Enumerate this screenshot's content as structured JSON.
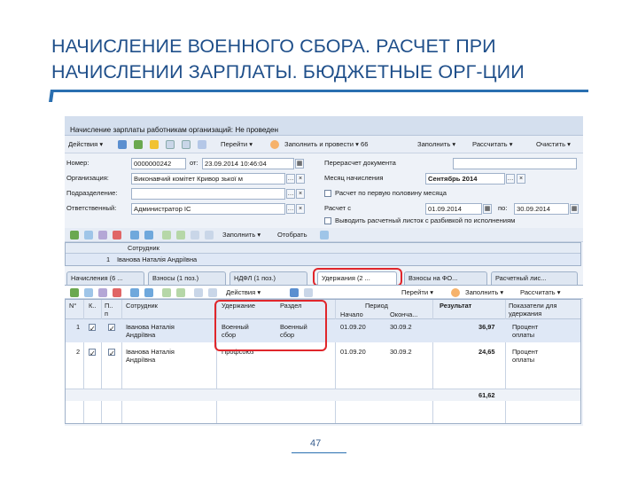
{
  "slide": {
    "title_line1": "НАЧИСЛЕНИЕ ВОЕННОГО СБОРА. РАСЧЕТ ПРИ",
    "title_line2": "НАЧИСЛЕНИИ ЗАРПЛАТЫ. БЮДЖЕТНЫЕ ОРГ-ЦИИ",
    "page_number": "47"
  },
  "window": {
    "title": "Начисление зарплаты работникам организаций: Не проведен"
  },
  "toolbar": {
    "actions": "Действия ▾",
    "goto": "Перейти ▾",
    "fill_create": "Заполнить и провести ▾ 66",
    "fill": "Заполнить ▾",
    "calculate": "Рассчитать ▾",
    "clear": "Очистить ▾"
  },
  "form": {
    "number_label": "Номер:",
    "number_value": "0000000242",
    "from_label": "от:",
    "date_value": "23.09.2014 10:46:04",
    "org_label": "Организация:",
    "org_value": "Виконавчий комітет Кривор зької м",
    "dept_label": "Подразделение:",
    "dept_value": "",
    "resp_label": "Ответственный:",
    "resp_value": "Администратор ІС",
    "recalc_label": "Перерасчет документа",
    "month_label": "Месяц начисления",
    "month_value": "Сентябрь 2014",
    "half_label": "Расчет по первую половину месяца",
    "calc_from_label": "Расчет с",
    "calc_from_value": "01.09.2014",
    "calc_to_label": "по:",
    "calc_to_value": "30.09.2014",
    "separate_label": "Выводить расчетный листок с разбивкой по исполнениям"
  },
  "employees_toolbar": {
    "fill": "Заполнить ▾",
    "select": "Отобрать"
  },
  "employees": {
    "col_employee": "Сотрудник",
    "rows": [
      {
        "num": "1",
        "name": "Іванова Наталія Андріївна"
      }
    ]
  },
  "tabs": [
    {
      "label": "Начисления (6 ..."
    },
    {
      "label": "Взносы (1 поз.)"
    },
    {
      "label": "НДФЛ (1 поз.)"
    },
    {
      "label": "Удержания (2 ..."
    },
    {
      "label": "Взносы на ФО..."
    },
    {
      "label": "Расчетный лис..."
    }
  ],
  "deductions_toolbar": {
    "actions": "Действия ▾",
    "goto": "Перейти ▾",
    "fill": "Заполнить ▾",
    "calculate": "Рассчитать ▾"
  },
  "deductions": {
    "col_num": "N°",
    "col_k": "К..",
    "col_p": "П..\nп",
    "col_employee": "Сотрудник",
    "col_deduction": "Удержание",
    "col_section": "Раздел",
    "col_period": "Период",
    "col_start": "Начало",
    "col_end": "Оконча...",
    "col_result": "Результат",
    "col_indicators": "Показатели для удержания",
    "rows": [
      {
        "num": "1",
        "employee_line1": "Іванова Наталія",
        "employee_line2": "Андріївна",
        "deduction_line1": "Военный",
        "deduction_line2": "сбор",
        "section_line1": "Военный",
        "section_line2": "сбор",
        "start": "01.09.20",
        "end": "30.09.2",
        "result": "36,97",
        "indicator_line1": "Процент",
        "indicator_line2": "оплаты"
      },
      {
        "num": "2",
        "employee_line1": "Іванова Наталія",
        "employee_line2": "Андріївна",
        "deduction_line1": "Профсоюз",
        "deduction_line2": "",
        "section_line1": "",
        "section_line2": "",
        "start": "01.09.20",
        "end": "30.09.2",
        "result": "24,65",
        "indicator_line1": "Процент",
        "indicator_line2": "оплаты"
      }
    ],
    "total": "61,62"
  },
  "colors": {
    "title": "#1f4f8a",
    "accent": "#2a6fb0",
    "highlight": "#e0262b"
  }
}
